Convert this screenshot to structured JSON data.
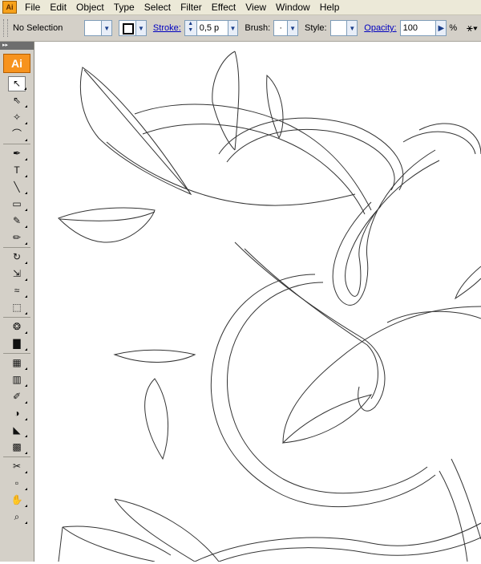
{
  "app": {
    "icon": "Ai"
  },
  "menu": [
    "File",
    "Edit",
    "Object",
    "Type",
    "Select",
    "Filter",
    "Effect",
    "View",
    "Window",
    "Help"
  ],
  "control_bar": {
    "selection": "No Selection",
    "stroke_label": "Stroke:",
    "stroke_value": "0,5 p",
    "brush_label": "Brush:",
    "brush_value": "·",
    "style_label": "Style:",
    "opacity_label": "Opacity:",
    "opacity_value": "100",
    "opacity_unit": "%"
  },
  "toolbar": {
    "logo": "Ai",
    "tools": [
      {
        "name": "selection-tool",
        "glyph": "↖"
      },
      {
        "name": "direct-selection-tool",
        "glyph": "⇖"
      },
      {
        "name": "magic-wand-tool",
        "glyph": "✧"
      },
      {
        "name": "lasso-tool",
        "glyph": "⌒"
      },
      {
        "name": "pen-tool",
        "glyph": "✒"
      },
      {
        "name": "type-tool",
        "glyph": "T"
      },
      {
        "name": "line-tool",
        "glyph": "╲"
      },
      {
        "name": "rectangle-tool",
        "glyph": "▭"
      },
      {
        "name": "paintbrush-tool",
        "glyph": "✎"
      },
      {
        "name": "pencil-tool",
        "glyph": "✏"
      },
      {
        "name": "rotate-tool",
        "glyph": "↻"
      },
      {
        "name": "scale-tool",
        "glyph": "⇲"
      },
      {
        "name": "warp-tool",
        "glyph": "≈"
      },
      {
        "name": "free-transform-tool",
        "glyph": "⬚"
      },
      {
        "name": "symbol-sprayer-tool",
        "glyph": "❂"
      },
      {
        "name": "column-graph-tool",
        "glyph": "▇"
      },
      {
        "name": "mesh-tool",
        "glyph": "▦"
      },
      {
        "name": "gradient-tool",
        "glyph": "▥"
      },
      {
        "name": "eyedropper-tool",
        "glyph": "✐"
      },
      {
        "name": "blend-tool",
        "glyph": "◑"
      },
      {
        "name": "live-paint-bucket-tool",
        "glyph": "◣"
      },
      {
        "name": "live-paint-selection-tool",
        "glyph": "▩"
      },
      {
        "name": "slice-tool",
        "glyph": "✂"
      },
      {
        "name": "eraser-tool",
        "glyph": "▫"
      },
      {
        "name": "hand-tool",
        "glyph": "✋"
      },
      {
        "name": "zoom-tool",
        "glyph": "⌕"
      }
    ]
  }
}
